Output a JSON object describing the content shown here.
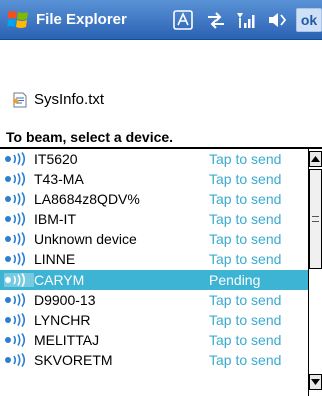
{
  "window": {
    "title": "File Explorer",
    "ok_label": "ok",
    "status_icons": [
      "start-logo-icon",
      "input-mode-icon",
      "connectivity-icon",
      "signal-icon",
      "volume-icon"
    ]
  },
  "file": {
    "name": "SysInfo.txt",
    "icon": "text-file-icon"
  },
  "beam": {
    "heading": "To beam, select a device."
  },
  "devices": [
    {
      "name": "IT5620",
      "status": "Tap to send",
      "selected": false
    },
    {
      "name": "T43-MA",
      "status": "Tap to send",
      "selected": false
    },
    {
      "name": "LA8684z8QDV%",
      "status": "Tap to send",
      "selected": false
    },
    {
      "name": "IBM-IT",
      "status": "Tap to send",
      "selected": false
    },
    {
      "name": "Unknown device",
      "status": "Tap to send",
      "selected": false
    },
    {
      "name": "LINNE",
      "status": "Tap to send",
      "selected": false
    },
    {
      "name": "CARYM",
      "status": "Pending",
      "selected": true
    },
    {
      "name": "D9900-13",
      "status": "Tap to send",
      "selected": false
    },
    {
      "name": "LYNCHR",
      "status": "Tap to send",
      "selected": false
    },
    {
      "name": "MELITTAJ",
      "status": "Tap to send",
      "selected": false
    },
    {
      "name": "SKVORETM",
      "status": "Tap to send",
      "selected": false
    }
  ],
  "colors": {
    "title_bar": "#2a62b4",
    "status_text": "#3aaad0",
    "selected_row": "#3db4d4"
  }
}
